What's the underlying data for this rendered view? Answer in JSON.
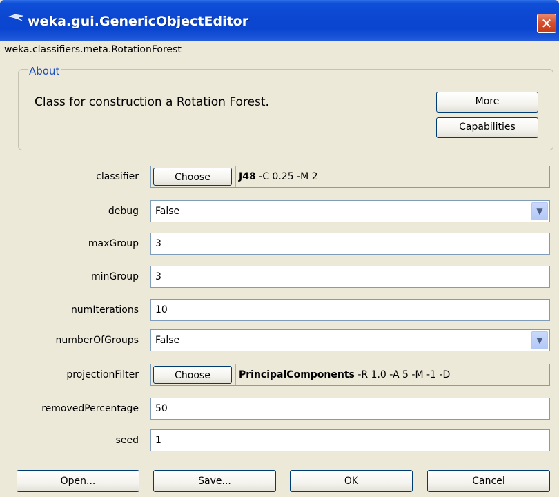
{
  "window": {
    "title": "weka.gui.GenericObjectEditor",
    "close_label": "✕"
  },
  "class_name": "weka.classifiers.meta.RotationForest",
  "about": {
    "legend": "About",
    "text": "Class for construction a Rotation Forest.",
    "more_label": "More",
    "capabilities_label": "Capabilities"
  },
  "properties": {
    "classifier": {
      "label": "classifier",
      "button": "Choose",
      "value_bold": "J48",
      "value_rest": " -C 0.25 -M 2"
    },
    "debug": {
      "label": "debug",
      "value": "False"
    },
    "maxGroup": {
      "label": "maxGroup",
      "value": "3"
    },
    "minGroup": {
      "label": "minGroup",
      "value": "3"
    },
    "numIterations": {
      "label": "numIterations",
      "value": "10"
    },
    "numberOfGroups": {
      "label": "numberOfGroups",
      "value": "False"
    },
    "projectionFilter": {
      "label": "projectionFilter",
      "button": "Choose",
      "value_bold": "PrincipalComponents",
      "value_rest": " -R 1.0 -A 5 -M -1 -D"
    },
    "removedPercentage": {
      "label": "removedPercentage",
      "value": "50"
    },
    "seed": {
      "label": "seed",
      "value": "1"
    }
  },
  "footer": {
    "open_label": "Open...",
    "save_label": "Save...",
    "ok_label": "OK",
    "cancel_label": "Cancel"
  },
  "icons": {
    "window": "weka-bird-icon",
    "combo": "chevron-down-icon"
  },
  "colors": {
    "titlebar": "#0a45d0",
    "about_legend": "#1a4fc4",
    "window_bg": "#ece9d8",
    "close_button": "#d6502e"
  }
}
